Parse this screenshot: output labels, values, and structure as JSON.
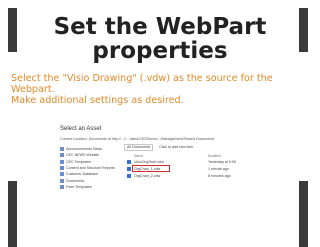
{
  "slide": {
    "title_line1": "Set the WebPart",
    "title_line2": "properties",
    "subtitle_line1": "Select the \"Visio Drawing\" (.vdw) as the source for the",
    "subtitle_line2": "Webpart.",
    "subtitle_line3": "Make additional settings as desired.",
    "accent_color": "#e08a2a"
  },
  "dialog": {
    "title": "Select an Asset",
    "location": "Current Location: Documents at http://...//..../sites/CEODemo/.../Management/Shared Documents",
    "nav_items": [
      {
        "label": "Announcements News",
        "icon": "list-icon"
      },
      {
        "label": "CEC NEWS Website",
        "icon": "list-icon"
      },
      {
        "label": "CEC Templates",
        "icon": "list-icon"
      },
      {
        "label": "Content and Structure Reports",
        "icon": "list-icon"
      },
      {
        "label": "Customer Database",
        "icon": "list-icon"
      },
      {
        "label": "Documents",
        "icon": "library-icon"
      },
      {
        "label": "Form Templates",
        "icon": "library-icon"
      }
    ],
    "toolbar": {
      "view_label": "All Documents",
      "upload_label": "Click to add new item"
    },
    "columns": {
      "name": "Name",
      "modified": "Modified",
      "by": ""
    },
    "files": [
      {
        "name": "VisioOrgChart.vdw",
        "modified": "Yesterday at 9:06"
      },
      {
        "name": "OrgChart_1.vdw",
        "modified": "1 minute ago"
      },
      {
        "name": "OrgChart_2.vdw",
        "modified": "8 minutes ago"
      }
    ],
    "highlight_color": "#d62b2b"
  }
}
